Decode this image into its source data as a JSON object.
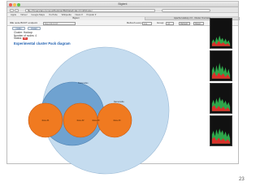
{
  "window": {
    "title": "Bigtent",
    "url": "file:///Users/anonymous/Desktop/BigData/index.html#cluster",
    "traffic_lights": [
      "#ee5a52",
      "#f4bd4f",
      "#5ec449"
    ]
  },
  "nav": {
    "back": "‹",
    "forward": "›"
  },
  "bookmarks": [
    "Apple",
    "Yahoo!",
    "Google Maps",
    "YouTube",
    "Wikipedia",
    "News ▾",
    "Popular ▾"
  ],
  "tabs": [
    "Bigtent",
    "Apache Hadoop 2.0 - Cluster Overview"
  ],
  "app_header": {
    "node_label": "IDE node BOOT endpoint",
    "node_value": "http://10.0.0.8",
    "refresh_label": "Refresh every:",
    "refresh_value": "10s",
    "group_label": "Group:",
    "group_value": "All",
    "refresh_button": "Refresh",
    "reset_button": "Reset"
  },
  "buttons": {
    "nodes": "nodes",
    "cluster": "cluster"
  },
  "info": {
    "cluster_label": "Cluster:",
    "cluster_value": "Hadoop",
    "nodes_label": "Number of nodes:",
    "nodes_value": "4",
    "status_label": "Status:",
    "status_value": "OK"
  },
  "diagram": {
    "title": "Experimental cluster Pack diagram",
    "outer_label": "",
    "group_label": "Datanodes",
    "right_label": "Namenode",
    "nodes": [
      "slave-01",
      "slave-02",
      "slave-03",
      "slave-04"
    ]
  },
  "colors": {
    "outer_fill": "#c5dcef",
    "group_fill": "#6fa2d0",
    "node_fill": "#f07a20",
    "node_stroke": "#c85a10",
    "title_color": "#2060b0"
  },
  "thumbnails": [
    "cpu-chart-1",
    "cpu-chart-2",
    "cpu-chart-3",
    "cpu-chart-4"
  ],
  "page_number": "23"
}
